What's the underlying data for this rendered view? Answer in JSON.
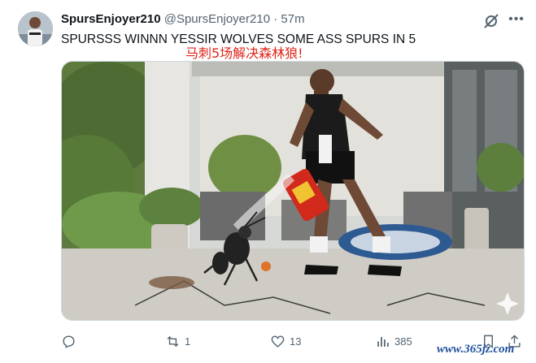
{
  "post": {
    "display_name": "SpursEnjoyer210",
    "handle": "@SpursEnjoyer210",
    "separator": "·",
    "time": "57m",
    "text": "SPURSSS WINNN YESSIR WOLVES SOME ASS SPURS IN 5",
    "image_caption_overlay": "马刺5场解决森林狼!",
    "more_label": "•••"
  },
  "actions": {
    "reply_count": "",
    "repost_count": "1",
    "like_count": "13",
    "views_count": "385"
  },
  "watermark": "www.365jz.com",
  "icons": [
    "grok-icon",
    "more-icon",
    "reply-icon",
    "repost-icon",
    "like-icon",
    "views-icon",
    "bookmark-icon",
    "share-icon"
  ],
  "colors": {
    "text": "#0f1419",
    "secondary": "#536471",
    "caption": "#e0261a"
  }
}
